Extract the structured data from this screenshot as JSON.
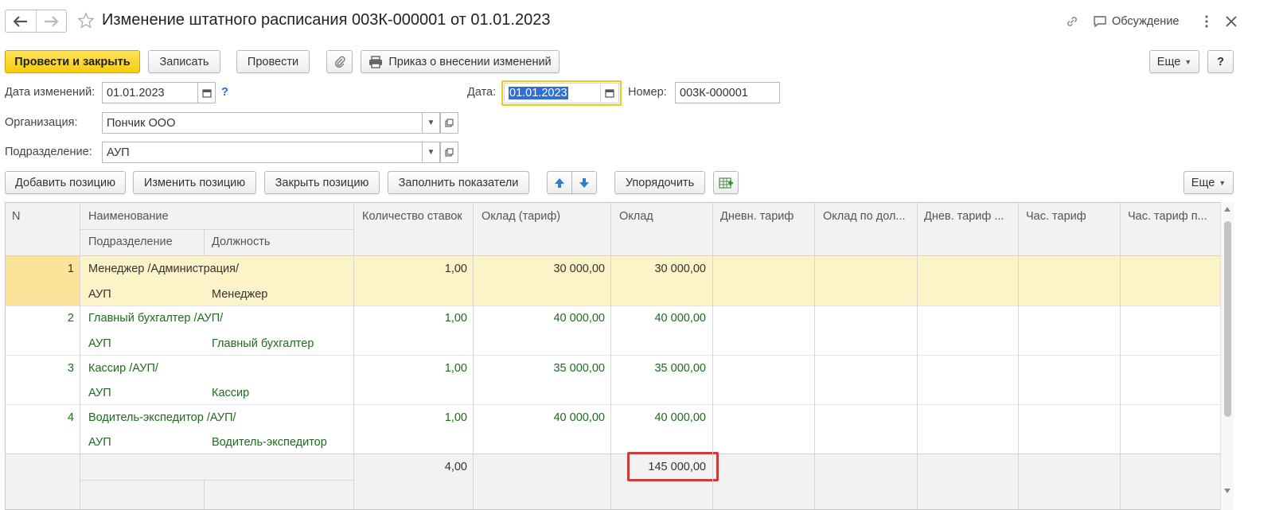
{
  "window": {
    "title": "Изменение штатного расписания 003К-000001 от 01.01.2023",
    "discussion_label": "Обсуждение"
  },
  "toolbar": {
    "post_close": "Провести и закрыть",
    "save": "Записать",
    "post": "Провести",
    "print_order": "Приказ о внесении изменений",
    "more": "Еще",
    "help": "?"
  },
  "form": {
    "change_date_label": "Дата изменений:",
    "change_date_value": "01.01.2023",
    "hint": "?",
    "date_label": "Дата:",
    "date_value": "01.01.2023",
    "number_label": "Номер:",
    "number_value": "003К-000001",
    "org_label": "Организация:",
    "org_value": "Пончик ООО",
    "dept_label": "Подразделение:",
    "dept_value": "АУП"
  },
  "table_toolbar": {
    "add_position": "Добавить позицию",
    "change_position": "Изменить позицию",
    "close_position": "Закрыть позицию",
    "fill_indicators": "Заполнить показатели",
    "sort": "Упорядочить",
    "more": "Еще"
  },
  "table": {
    "headers": {
      "n": "N",
      "name": "Наименование",
      "dept": "Подразделение",
      "position": "Должность",
      "rates": "Количество ставок",
      "salary_tariff": "Оклад (тариф)",
      "salary": "Оклад",
      "day_tariff": "Дневн. тариф",
      "salary_by_pos": "Оклад по дол...",
      "day_tariff2": "Днев. тариф ...",
      "hour_tariff": "Час. тариф",
      "hour_tariff2": "Час. тариф п..."
    },
    "rows": [
      {
        "n": "1",
        "name": "Менеджер /Администрация/",
        "dept": "АУП",
        "position": "Менеджер",
        "rates": "1,00",
        "salary_tariff": "30 000,00",
        "salary": "30 000,00"
      },
      {
        "n": "2",
        "name": "Главный бухгалтер  /АУП/",
        "dept": "АУП",
        "position": "Главный бухгалтер",
        "rates": "1,00",
        "salary_tariff": "40 000,00",
        "salary": "40 000,00"
      },
      {
        "n": "3",
        "name": "Кассир /АУП/",
        "dept": "АУП",
        "position": "Кассир",
        "rates": "1,00",
        "salary_tariff": "35 000,00",
        "salary": "35 000,00"
      },
      {
        "n": "4",
        "name": "Водитель-экспедитор /АУП/",
        "dept": "АУП",
        "position": "Водитель-экспедитор",
        "rates": "1,00",
        "salary_tariff": "40 000,00",
        "salary": "40 000,00"
      }
    ],
    "totals": {
      "rates": "4,00",
      "salary": "145 000,00"
    }
  },
  "colors": {
    "accent_yellow": "#f5cd0e",
    "selected_row": "#fdf3c9",
    "selected_cell": "#fbe39a",
    "green_text": "#1d6b1d",
    "highlight_red": "#cc3b3b"
  },
  "icons": [
    "back-arrow-icon",
    "forward-arrow-icon",
    "star-icon",
    "link-icon",
    "chat-icon",
    "more-vertical-icon",
    "close-icon",
    "paperclip-icon",
    "printer-icon",
    "calendar-icon",
    "dropdown-icon",
    "open-icon",
    "arrow-up-icon",
    "arrow-down-icon",
    "table-settings-icon"
  ]
}
